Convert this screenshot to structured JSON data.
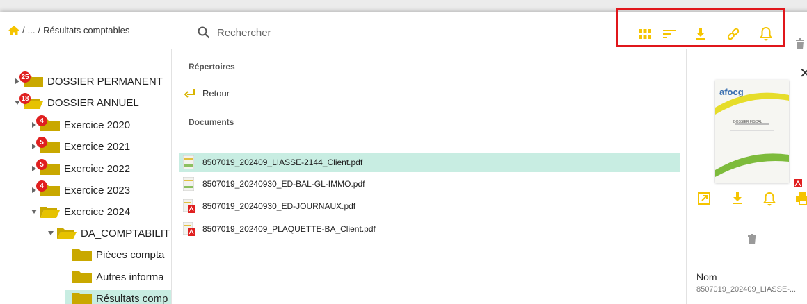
{
  "breadcrumb": {
    "separator": "/",
    "ellipsis": "...",
    "current": "Résultats comptables"
  },
  "search": {
    "placeholder": "Rechercher"
  },
  "toolbar": {
    "icons": [
      "grid-view-icon",
      "sort-icon",
      "download-icon",
      "link-icon",
      "bell-icon",
      "trash-icon"
    ],
    "accent": "#f5c400",
    "highlight_color": "#e0161b"
  },
  "tree": {
    "items": [
      {
        "label": "DOSSIER PERMANENT",
        "badge": "25"
      },
      {
        "label": "DOSSIER ANNUEL",
        "badge": "18"
      },
      {
        "label": "Exercice 2020",
        "badge": "4"
      },
      {
        "label": "Exercice 2021",
        "badge": "5"
      },
      {
        "label": "Exercice 2022",
        "badge": "5"
      },
      {
        "label": "Exercice 2023",
        "badge": "4"
      },
      {
        "label": "Exercice 2024",
        "badge": ""
      },
      {
        "label": "DA_COMPTABILIT",
        "badge": ""
      },
      {
        "label": "Pièces compta",
        "badge": ""
      },
      {
        "label": "Autres informa",
        "badge": ""
      },
      {
        "label": "Résultats comp",
        "badge": ""
      }
    ]
  },
  "main": {
    "dirs_header": "Répertoires",
    "back_label": "Retour",
    "docs_header": "Documents",
    "documents": [
      {
        "name": "8507019_202409_LIASSE-2144_Client.pdf"
      },
      {
        "name": "8507019_20240930_ED-BAL-GL-IMMO.pdf"
      },
      {
        "name": "8507019_20240930_ED-JOURNAUX.pdf"
      },
      {
        "name": "8507019_202409_PLAQUETTE-BA_Client.pdf"
      }
    ]
  },
  "preview": {
    "close": "✕",
    "thumb_logo": "afocg",
    "thumb_title": "DOSSIER FISCAL",
    "name_label": "Nom",
    "name_value": "8507019_202409_LIASSE-..."
  }
}
